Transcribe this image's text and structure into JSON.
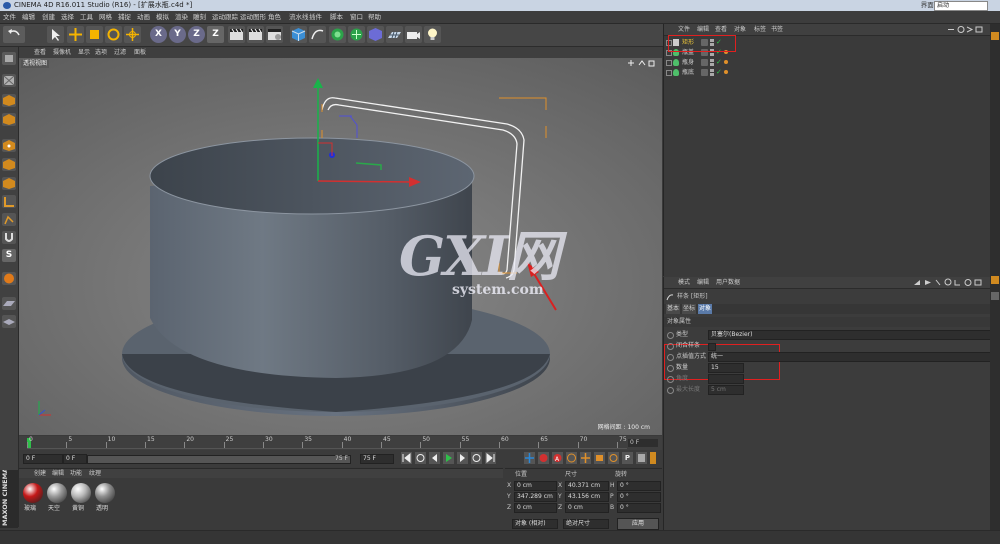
{
  "window": {
    "title": "CINEMA 4D R16.011 Studio (R16) - [扩展水瓶.c4d *]",
    "layout_label": "界面:",
    "layout_value": "启动"
  },
  "menu": [
    "文件",
    "编辑",
    "创建",
    "选择",
    "工具",
    "网格",
    "捕捉",
    "动画",
    "模拟",
    "渲染",
    "雕刻",
    "运动跟踪",
    "运动图形",
    "角色",
    "流水线",
    "插件",
    "脚本",
    "窗口",
    "帮助"
  ],
  "viewport": {
    "menu": [
      "查看",
      "摄像机",
      "显示",
      "选项",
      "过滤",
      "面板"
    ],
    "label": "透视视图",
    "grid_info": "网格间距 : 100 cm"
  },
  "watermark": {
    "big": "GXI网",
    "small": "system.com"
  },
  "timeline": {
    "ticks": [
      "0",
      "5",
      "10",
      "15",
      "20",
      "25",
      "30",
      "35",
      "40",
      "45",
      "50",
      "55",
      "60",
      "65",
      "70",
      "75"
    ],
    "frame_end": "0 F",
    "start_field": "0 F",
    "start_field2": "0 F",
    "end_field": "75 F",
    "end_field2": "75 F"
  },
  "materials": {
    "menu": [
      "创建",
      "编辑",
      "功能",
      "纹理"
    ],
    "items": [
      {
        "name": "玻璃",
        "color": "#c41818"
      },
      {
        "name": "天空",
        "color": "#9a9a9a"
      },
      {
        "name": "黄铜",
        "color": "#b8b8b8"
      },
      {
        "name": "透明",
        "color": "#8e8e8e"
      }
    ]
  },
  "coords": {
    "headers": [
      "位置",
      "尺寸",
      "旋转"
    ],
    "rows": [
      {
        "axis": "X",
        "pos": "0 cm",
        "size_axis": "X",
        "size": "40.371 cm",
        "rot_axis": "H",
        "rot": "0 °"
      },
      {
        "axis": "Y",
        "pos": "347.289 cm",
        "size_axis": "Y",
        "size": "43.156 cm",
        "rot_axis": "P",
        "rot": "0 °"
      },
      {
        "axis": "Z",
        "pos": "0 cm",
        "size_axis": "Z",
        "size": "0 cm",
        "rot_axis": "B",
        "rot": "0 °"
      }
    ],
    "mode": "对象 (相对)",
    "size_mode": "绝对尺寸",
    "apply": "应用"
  },
  "objects": {
    "menu": [
      "文件",
      "编辑",
      "查看",
      "对象",
      "标签",
      "书签"
    ],
    "items": [
      {
        "name": "矩形",
        "color": "#e8c23a"
      },
      {
        "name": "瓶盖",
        "color": "#cfcfcf"
      },
      {
        "name": "瓶身",
        "color": "#cfcfcf"
      },
      {
        "name": "瓶底",
        "color": "#cfcfcf"
      }
    ]
  },
  "attributes": {
    "menu": [
      "模式",
      "编辑",
      "用户数据"
    ],
    "object_title": "样条 [矩形]",
    "tabs": [
      "基本",
      "坐标",
      "对象"
    ],
    "section": "对象属性",
    "props": [
      {
        "label": "类型",
        "value": "贝塞尔(Bezier)"
      },
      {
        "label": "闭合样条",
        "value": ""
      },
      {
        "label": "点插值方式",
        "value": "统一"
      },
      {
        "label": "数量",
        "value": "15"
      },
      {
        "label": "角度",
        "value": ""
      },
      {
        "label": "最大长度",
        "value": "5 cm"
      }
    ]
  },
  "status": {
    "text": ""
  },
  "brand": {
    "name": "MAXON CINEMA 4D"
  }
}
